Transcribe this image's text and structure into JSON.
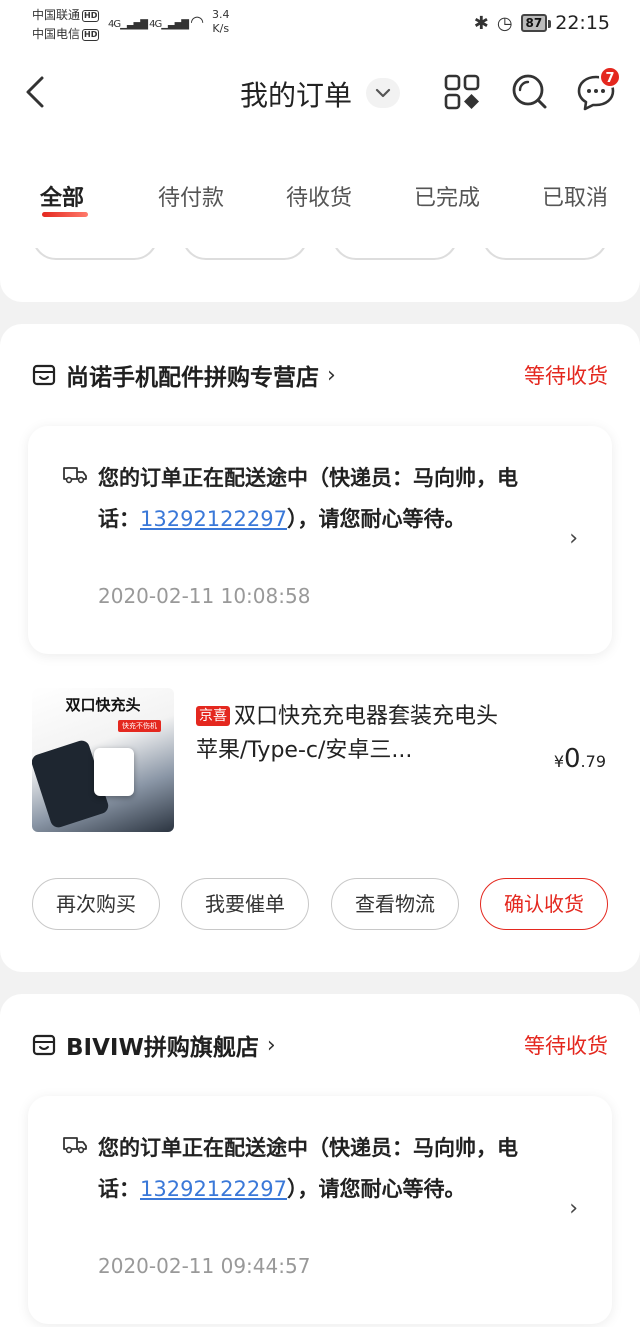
{
  "status_bar": {
    "carrier1": "中国联通",
    "carrier2": "中国电信",
    "hd": "HD",
    "signal": "4G",
    "speed_value": "3.4",
    "speed_unit": "K/s",
    "battery": "87",
    "time": "22:15"
  },
  "header": {
    "title": "我的订单",
    "badge_count": "7"
  },
  "tabs": [
    "全部",
    "待付款",
    "待收货",
    "已完成",
    "已取消"
  ],
  "orders": [
    {
      "shop": "尚诺手机配件拼购专营店",
      "status": "等待收货",
      "logistics": {
        "text_before": "您的订单正在配送途中（快递员：马向帅，电话：",
        "phone": "13292122297",
        "text_after": "），请您耐心等待。",
        "time": "2020-02-11 10:08:58"
      },
      "product": {
        "image_title": "双口快充头",
        "image_tag": "快充不伤机",
        "tag": "京喜",
        "title": "双口快充充电器套装充电头苹果/Type-c/安卓三...",
        "price_symbol": "¥",
        "price_int": "0",
        "price_dec": ".79"
      },
      "buttons": [
        "再次购买",
        "我要催单",
        "查看物流",
        "确认收货"
      ]
    },
    {
      "shop": "BIVIW拼购旗舰店",
      "status": "等待收货",
      "logistics": {
        "text_before": "您的订单正在配送途中（快递员：马向帅，电话：",
        "phone": "13292122297",
        "text_after": "），请您耐心等待。",
        "time": "2020-02-11 09:44:57"
      }
    }
  ]
}
